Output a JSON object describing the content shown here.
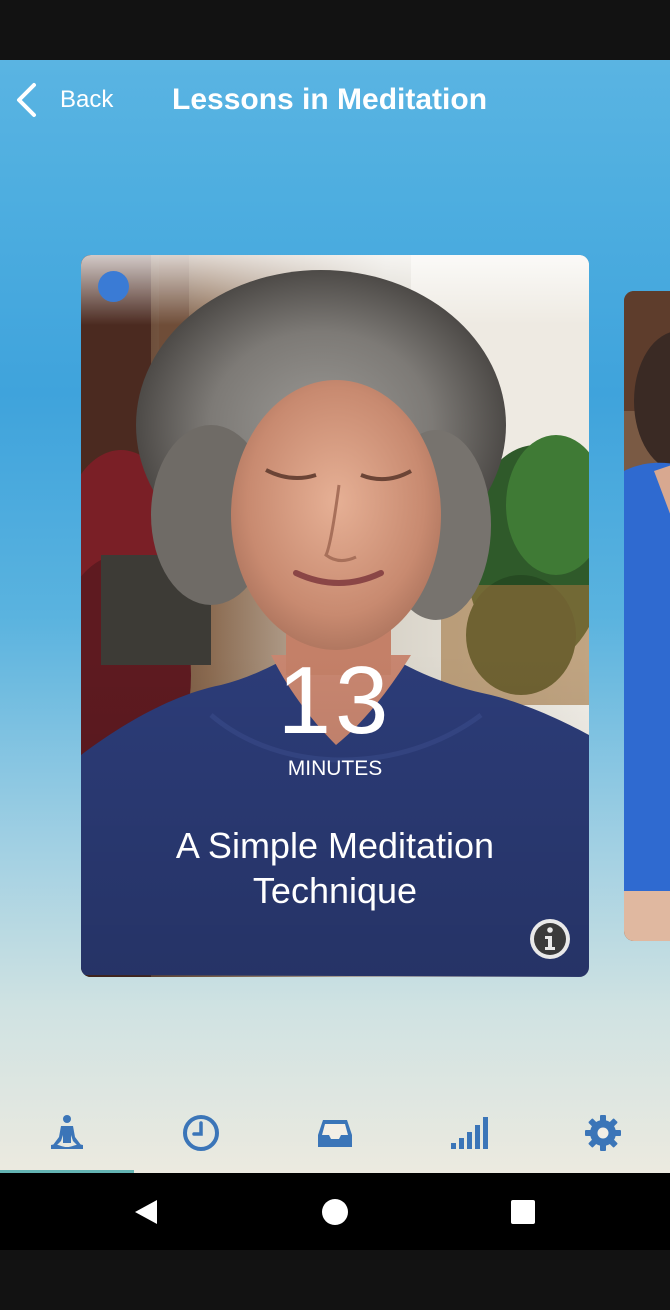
{
  "header": {
    "back_label": "Back",
    "title": "Lessons in Meditation"
  },
  "card": {
    "minutes_value": "13",
    "minutes_label": "MINUTES",
    "title": "A Simple Meditation Technique",
    "new_dot_color": "#3a7bd5"
  },
  "tabs": [
    {
      "icon": "meditation-icon",
      "active": true
    },
    {
      "icon": "clock-icon",
      "active": false
    },
    {
      "icon": "inbox-icon",
      "active": false
    },
    {
      "icon": "signal-bars-icon",
      "active": false
    },
    {
      "icon": "gear-icon",
      "active": false
    }
  ],
  "colors": {
    "accent": "#3b75b8",
    "tab_indicator": "#63b3b2"
  }
}
